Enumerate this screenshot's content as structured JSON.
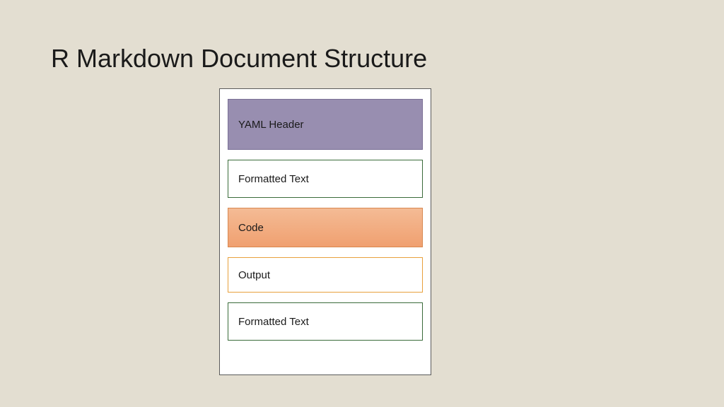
{
  "title": "R Markdown Document Structure",
  "sections": {
    "yaml": "YAML Header",
    "text1": "Formatted Text",
    "code": "Code",
    "output": "Output",
    "text2": "Formatted Text"
  }
}
